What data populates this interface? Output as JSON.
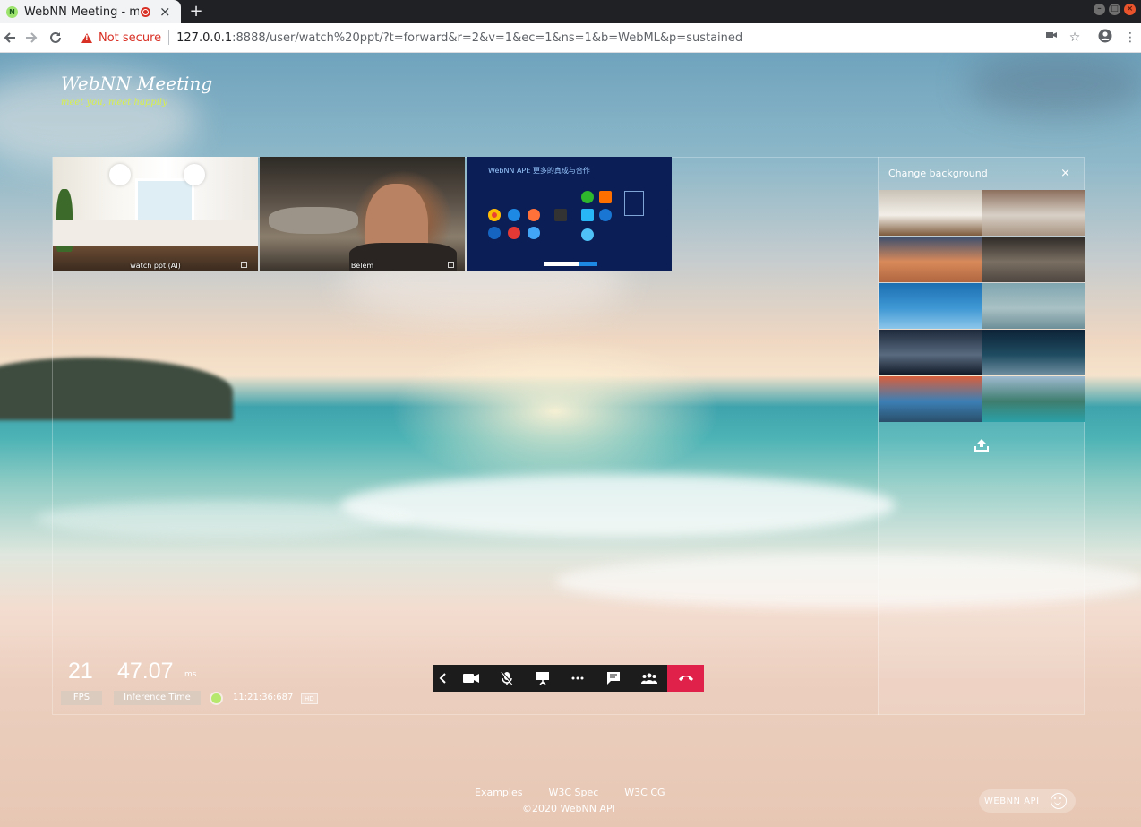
{
  "browser": {
    "tab_title": "WebNN Meeting - mee",
    "favicon_letter": "N",
    "new_tab": "+",
    "security_label": "Not secure",
    "url_host": "127.0.0.1",
    "url_rest": ":8888/user/watch%20ppt/?t=forward&r=2&v=1&ec=1&ns=1&b=WebML&p=sustained"
  },
  "brand": {
    "name": "WebNN Meeting",
    "tagline": "meet you, meet happily"
  },
  "videos": [
    {
      "label": "watch ppt (AI)",
      "scene": "kitchen"
    },
    {
      "label": "Belem",
      "scene": "hangar"
    },
    {
      "label": "",
      "scene": "slide",
      "slide_title": "WebNN API: 更多的真成与合作"
    }
  ],
  "background_panel": {
    "title": "Change background",
    "close": "×",
    "thumbnails": [
      {
        "name": "kitchen",
        "colors": [
          "#c9c2b6",
          "#f3efe8",
          "#7d5a3c"
        ]
      },
      {
        "name": "bookshelf",
        "colors": [
          "#8c6f5d",
          "#d8d0c6",
          "#a99482"
        ]
      },
      {
        "name": "sunset-pier",
        "colors": [
          "#3b4f6e",
          "#d98a5a",
          "#b06640"
        ]
      },
      {
        "name": "hangar",
        "colors": [
          "#2e2a27",
          "#7a6f62",
          "#4d4640"
        ]
      },
      {
        "name": "blue-sky",
        "colors": [
          "#1c6fb1",
          "#3f98d4",
          "#8cc6ea"
        ]
      },
      {
        "name": "pebbles",
        "colors": [
          "#7fa5b0",
          "#a9c1c4",
          "#6d8f98"
        ]
      },
      {
        "name": "office",
        "colors": [
          "#1e2a3c",
          "#596a7f",
          "#0f1724"
        ]
      },
      {
        "name": "galaxy",
        "colors": [
          "#0d2337",
          "#1f4c61",
          "#6f8ea0"
        ]
      },
      {
        "name": "canal-houses",
        "colors": [
          "#d95f3c",
          "#3c7fb5",
          "#2a4f6a"
        ]
      },
      {
        "name": "mountain-lake",
        "colors": [
          "#9fbad0",
          "#3e7d6e",
          "#2ba1a8"
        ]
      }
    ],
    "upload": "upload-icon"
  },
  "stats": {
    "fps": "21",
    "inference": "47.07",
    "unit": "ms",
    "fps_label": "FPS",
    "inference_label": "Inference Time",
    "time": "11:21:36:687",
    "quality": "HD"
  },
  "controls": [
    "collapse",
    "camera",
    "mute-mic",
    "present",
    "more",
    "chat",
    "participants",
    "hang-up"
  ],
  "footer": {
    "links": [
      "Examples",
      "W3C Spec",
      "W3C CG"
    ],
    "copyright": "©2020 WebNN API",
    "badge": "WEBNN API"
  },
  "colors": {
    "accent_green": "#d8ef4d",
    "hangup_red": "#e0224a",
    "insecure_red": "#d93025"
  }
}
